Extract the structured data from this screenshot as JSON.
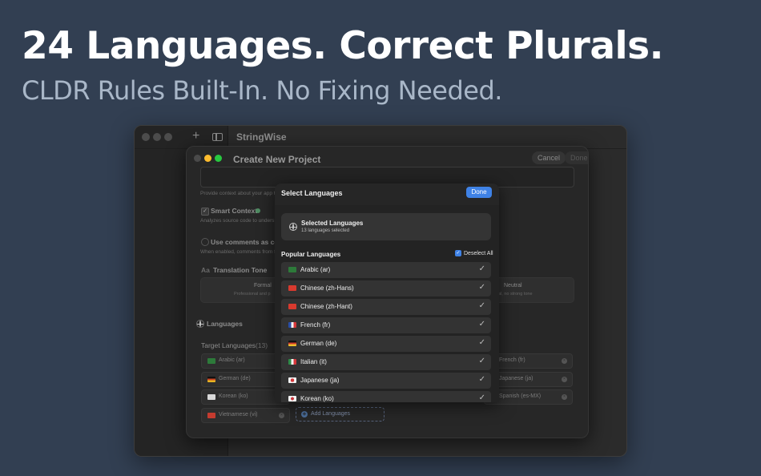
{
  "promo": {
    "headline": "24 Languages. Correct Plurals.",
    "subhead": "CLDR Rules Built-In. No Fixing Needed."
  },
  "app": {
    "title": "StringWise",
    "add_symbol": "+"
  },
  "sheet": {
    "title": "Create New Project",
    "cancel_label": "Cancel",
    "done_label": "Done",
    "context_hint": "Provide context about your app to",
    "smart_context_label": "Smart Context",
    "smart_context_hint": "Analyzes source code to understa",
    "use_comments_label": "Use comments as cont",
    "use_comments_hint": "When enabled, comments from fi",
    "tone_icon": "Aa",
    "tone_label": "Translation Tone",
    "tone_formal": "Formal",
    "tone_formal_hint": "Professional and p",
    "tone_neutral": "Neutral",
    "tone_neutral_hint": "al, no strong tone",
    "languages_label": "Languages",
    "target_label": "Target Languages",
    "target_count": "(13)",
    "target_chips": [
      {
        "label": "Arabic (ar)",
        "flag": "#2d7a3a"
      },
      {
        "label": "German (de)",
        "flag": "#c9a227"
      },
      {
        "label": "Korean (ko)",
        "flag": "#e6e6e6"
      },
      {
        "label": "Vietnamese (vi)",
        "flag": "#c43b2f"
      },
      {
        "label": "French (fr)"
      },
      {
        "label": "Japanese (ja)"
      },
      {
        "label": "Spanish (es-MX)"
      }
    ],
    "add_languages_label": "Add Languages",
    "add_symbol": "+"
  },
  "popover": {
    "title": "Select Languages",
    "done_label": "Done",
    "selected_title": "Selected Languages",
    "selected_count": "13 languages selected",
    "popular_title": "Popular Languages",
    "deselect_label": "Deselect All",
    "check_glyph": "✓",
    "languages": [
      {
        "label": "Arabic (ar)",
        "flag": "arabic"
      },
      {
        "label": "Chinese (zh-Hans)",
        "flag": "china"
      },
      {
        "label": "Chinese (zh-Hant)",
        "flag": "china"
      },
      {
        "label": "French (fr)",
        "flag": "france"
      },
      {
        "label": "German (de)",
        "flag": "germany"
      },
      {
        "label": "Italian (it)",
        "flag": "italy"
      },
      {
        "label": "Japanese (ja)",
        "flag": "japan"
      },
      {
        "label": "Korean (ko)",
        "flag": "korea"
      }
    ]
  },
  "colors": {
    "background": "#323f52",
    "accent": "#3f82e6",
    "traffic_close": "#ff5f57",
    "traffic_min": "#febc2e",
    "traffic_max": "#28c840"
  }
}
